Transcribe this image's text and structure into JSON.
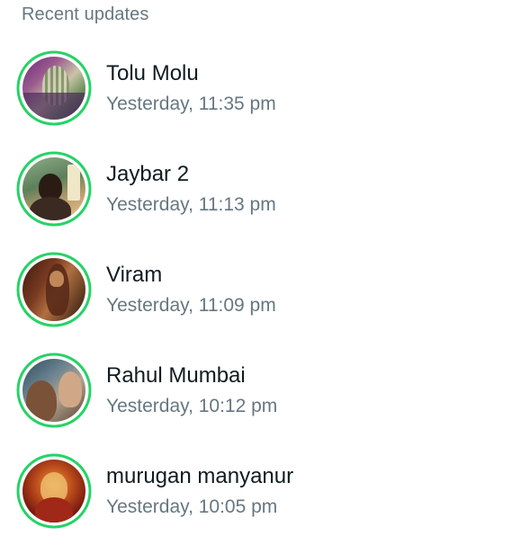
{
  "section": {
    "title": "Recent updates"
  },
  "ring_color": "#25d366",
  "updates": [
    {
      "name": "Tolu Molu",
      "time": "Yesterday, 11:35 pm"
    },
    {
      "name": "Jaybar 2",
      "time": "Yesterday, 11:13 pm"
    },
    {
      "name": "Viram",
      "time": "Yesterday, 11:09 pm"
    },
    {
      "name": "Rahul Mumbai",
      "time": "Yesterday, 10:12 pm"
    },
    {
      "name": "murugan manyanur",
      "time": "Yesterday, 10:05 pm"
    }
  ]
}
